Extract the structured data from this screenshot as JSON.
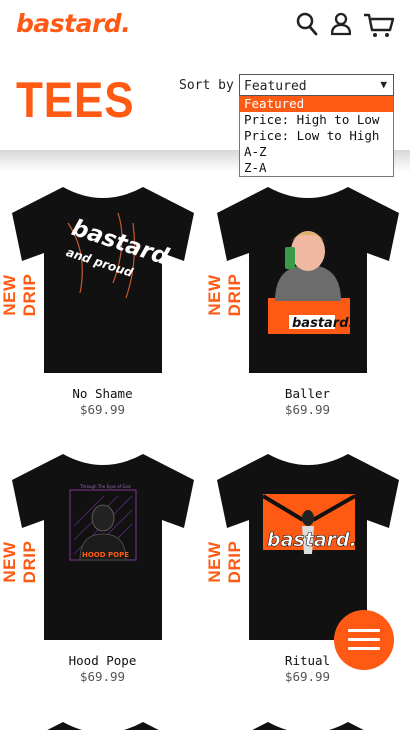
{
  "header": {
    "logo": "bastard.",
    "icons": [
      "search-icon",
      "account-icon",
      "cart-icon"
    ]
  },
  "page": {
    "title": "TEES",
    "sort_label": "Sort by",
    "sort_selected": "Featured",
    "sort_options": [
      "Featured",
      "Price: High to Low",
      "Price: Low to High",
      "A-Z",
      "Z-A"
    ]
  },
  "products": [
    {
      "name": "No Shame",
      "price": "$69.99",
      "badge": "NEW DRIP",
      "print_text": "bastard",
      "print_subtext": "and proud"
    },
    {
      "name": "Baller",
      "price": "$69.99",
      "badge": "NEW DRIP",
      "print_text": "bastard."
    },
    {
      "name": "Hood Pope",
      "price": "$69.99",
      "badge": "NEW DRIP",
      "print_text": "HOOD POPE",
      "print_subtext": "Through The Eyes of God"
    },
    {
      "name": "Ritual",
      "price": "$69.99",
      "badge": "NEW DRIP",
      "print_text": "bastard."
    }
  ],
  "colors": {
    "brand": "#ff5a14",
    "tee": "#111111"
  },
  "menu_button_icon": "hamburger-icon"
}
